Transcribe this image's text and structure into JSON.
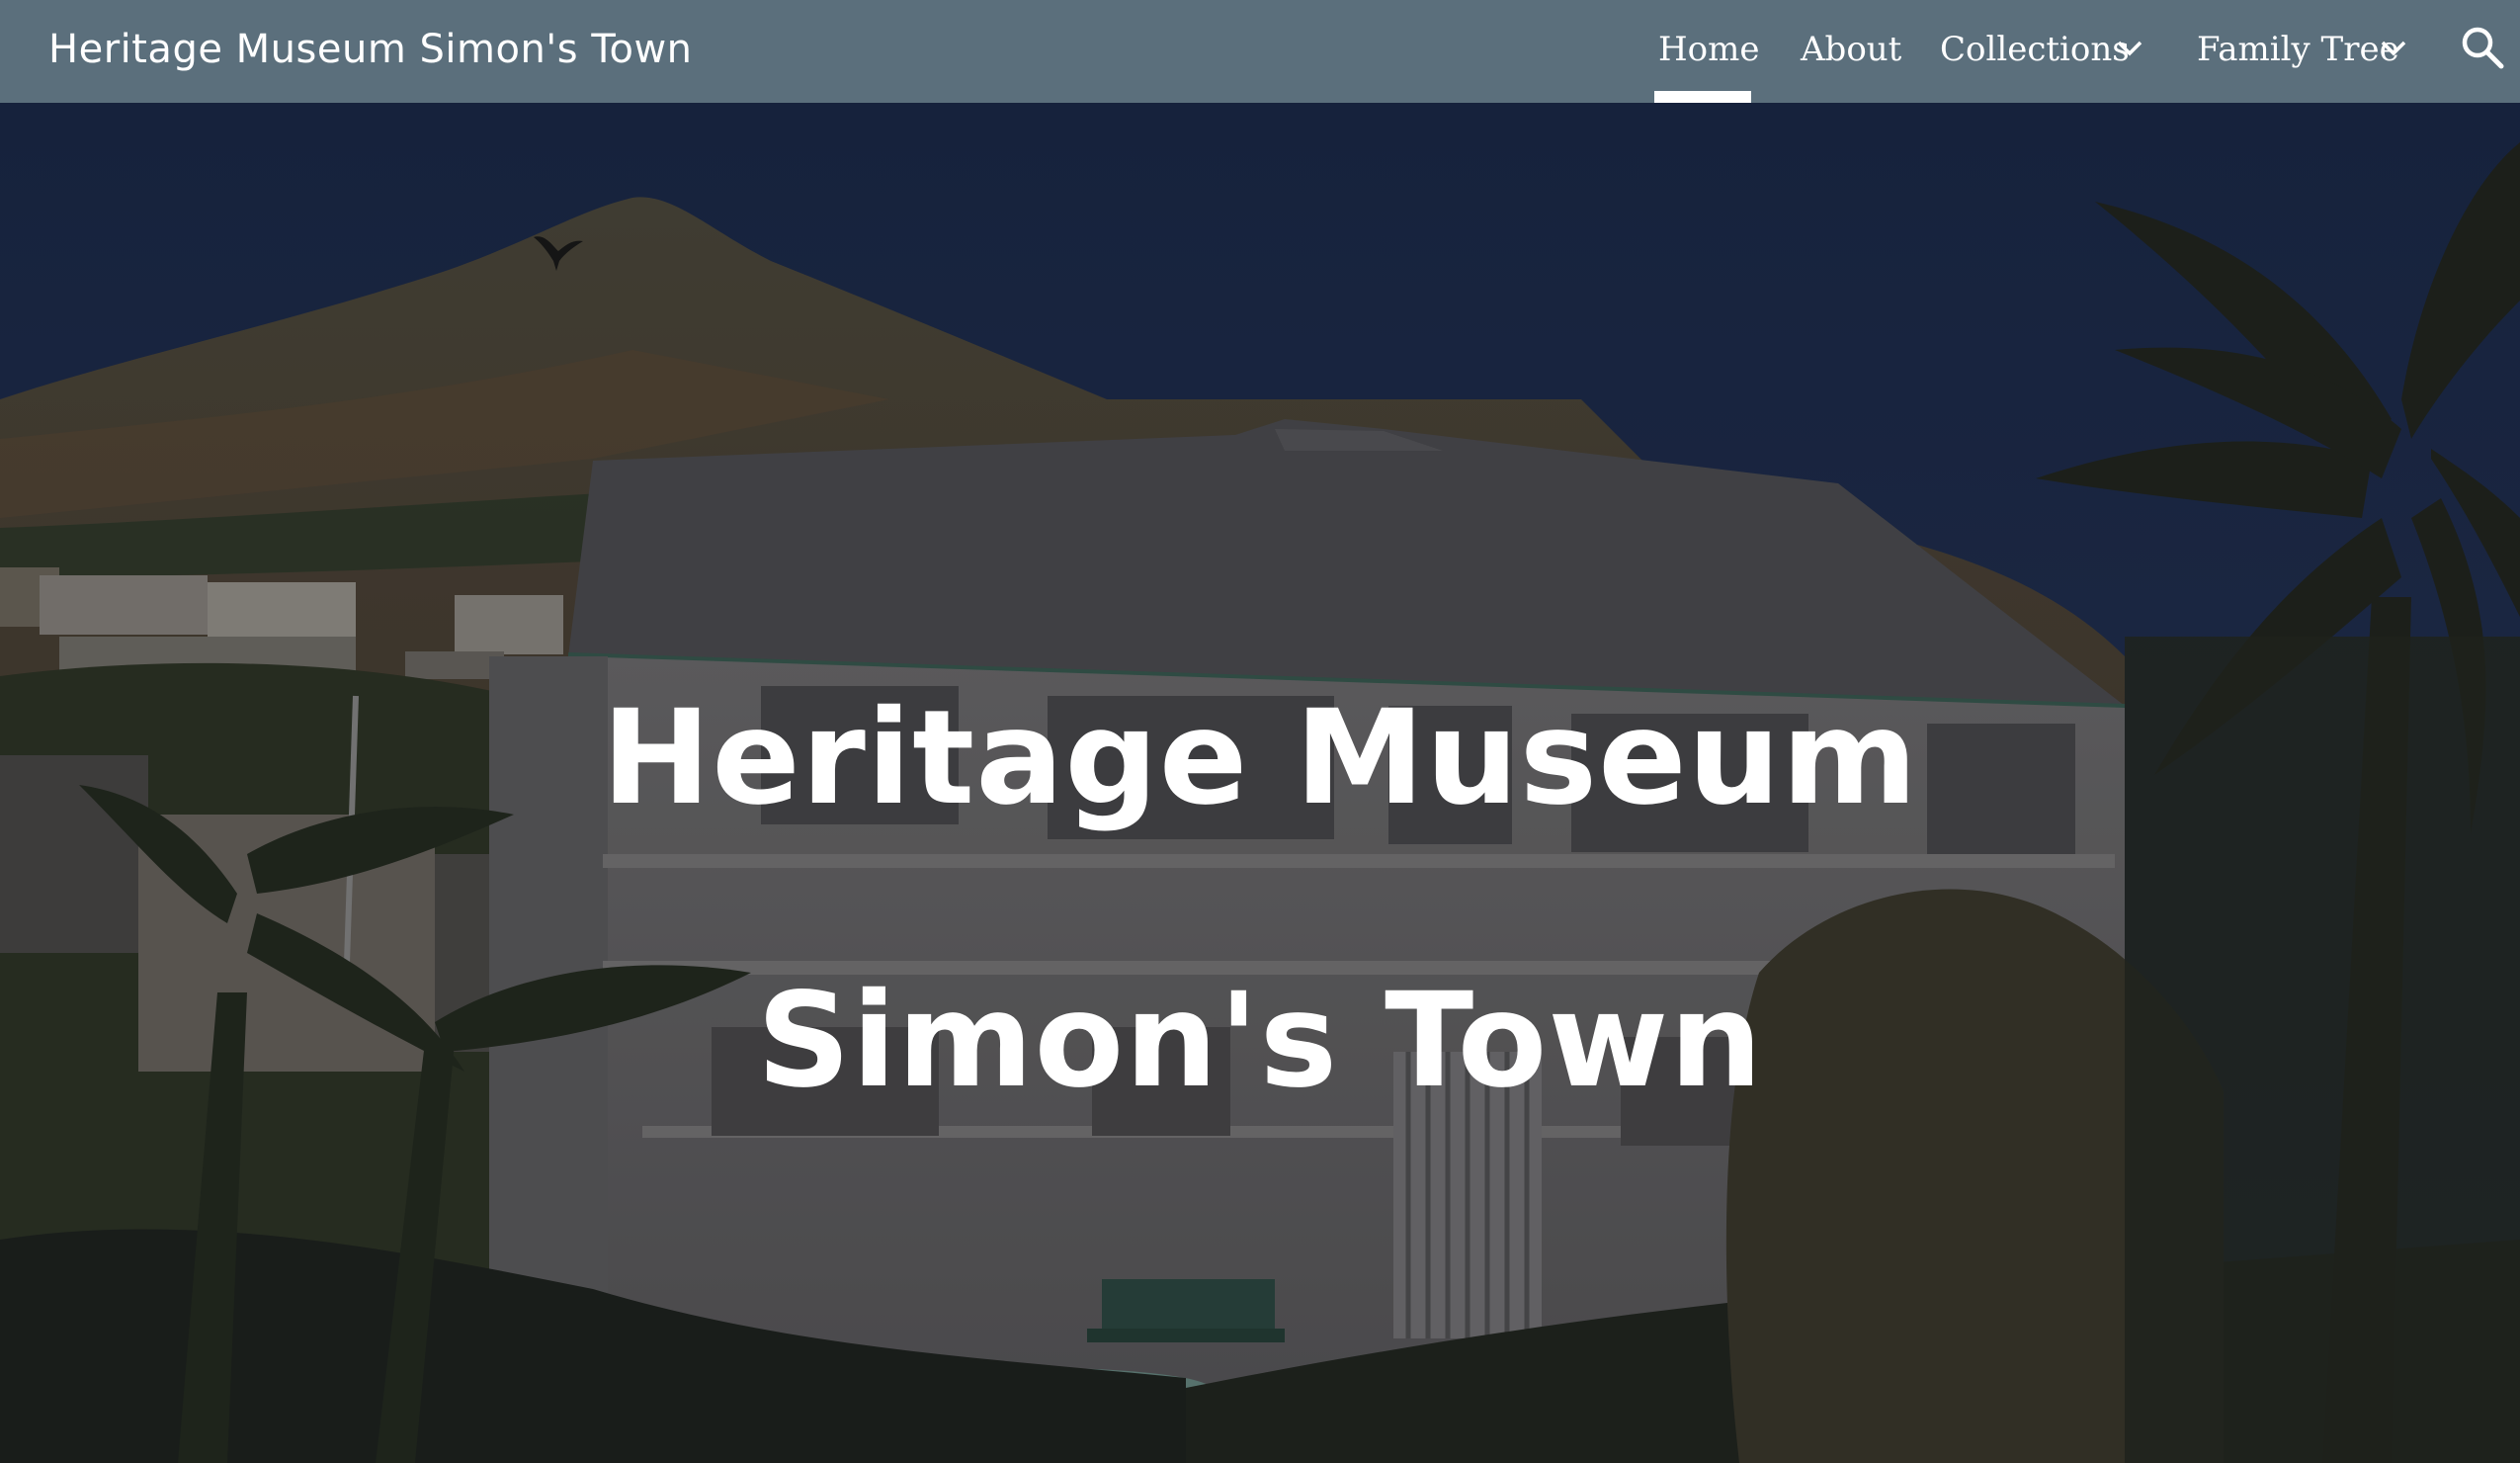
{
  "header": {
    "site_title": "Heritage Museum Simon's Town",
    "nav": [
      {
        "label": "Home",
        "active": true
      },
      {
        "label": "About"
      },
      {
        "label": "Collections",
        "has_dropdown": true
      },
      {
        "label": "Family Tree",
        "has_dropdown": true
      }
    ],
    "search_icon": "search-icon",
    "bar_color": "#5b6f7c"
  },
  "hero": {
    "title_line1": "Heritage Museum",
    "title_line2": "Simon's Town"
  }
}
